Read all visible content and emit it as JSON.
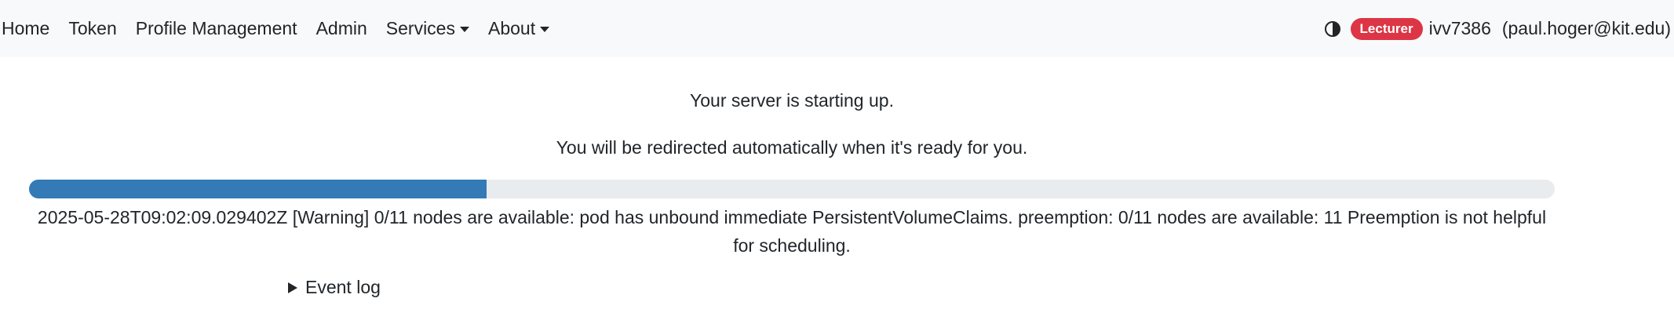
{
  "nav": {
    "items": [
      {
        "label": "Home"
      },
      {
        "label": "Token"
      },
      {
        "label": "Profile Management"
      },
      {
        "label": "Admin"
      },
      {
        "label": "Services",
        "dropdown": true
      },
      {
        "label": "About",
        "dropdown": true
      }
    ],
    "theme_icon": "contrast-icon",
    "role_badge": "Lecturer",
    "username": "ivv7386",
    "email": "(paul.hoger@kit.edu)"
  },
  "main": {
    "message1": "Your server is starting up.",
    "message2": "You will be redirected automatically when it's ready for you.",
    "progress_fraction": 0.3,
    "status": "2025-05-28T09:02:09.029402Z [Warning] 0/11 nodes are available: pod has unbound immediate PersistentVolumeClaims. preemption: 0/11 nodes are available: 11 Preemption is not helpful for scheduling.",
    "event_log_label": "Event log"
  },
  "colors": {
    "navbar_bg": "#f8f9fa",
    "badge_bg": "#dc3545",
    "progress_fill": "#337ab7",
    "progress_track": "#e9ecef"
  }
}
